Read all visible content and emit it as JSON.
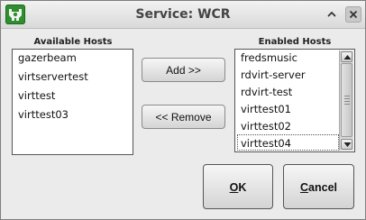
{
  "window": {
    "title": "Service: WCR"
  },
  "available": {
    "label": "Available Hosts",
    "items": [
      "gazerbeam",
      "virtservertest",
      "virttest",
      "virttest03"
    ]
  },
  "enabled": {
    "label": "Enabled Hosts",
    "items": [
      "fredsmusic",
      "rdvirt-server",
      "rdvirt-test",
      "virttest01",
      "virttest02",
      "virttest04"
    ],
    "selected": "virttest04"
  },
  "buttons": {
    "add": "Add >>",
    "remove": "<< Remove",
    "ok_mnemonic": "O",
    "ok_rest": "K",
    "cancel_mnemonic": "C",
    "cancel_rest": "ancel"
  },
  "colors": {
    "app_icon": "#2f8f2f"
  }
}
